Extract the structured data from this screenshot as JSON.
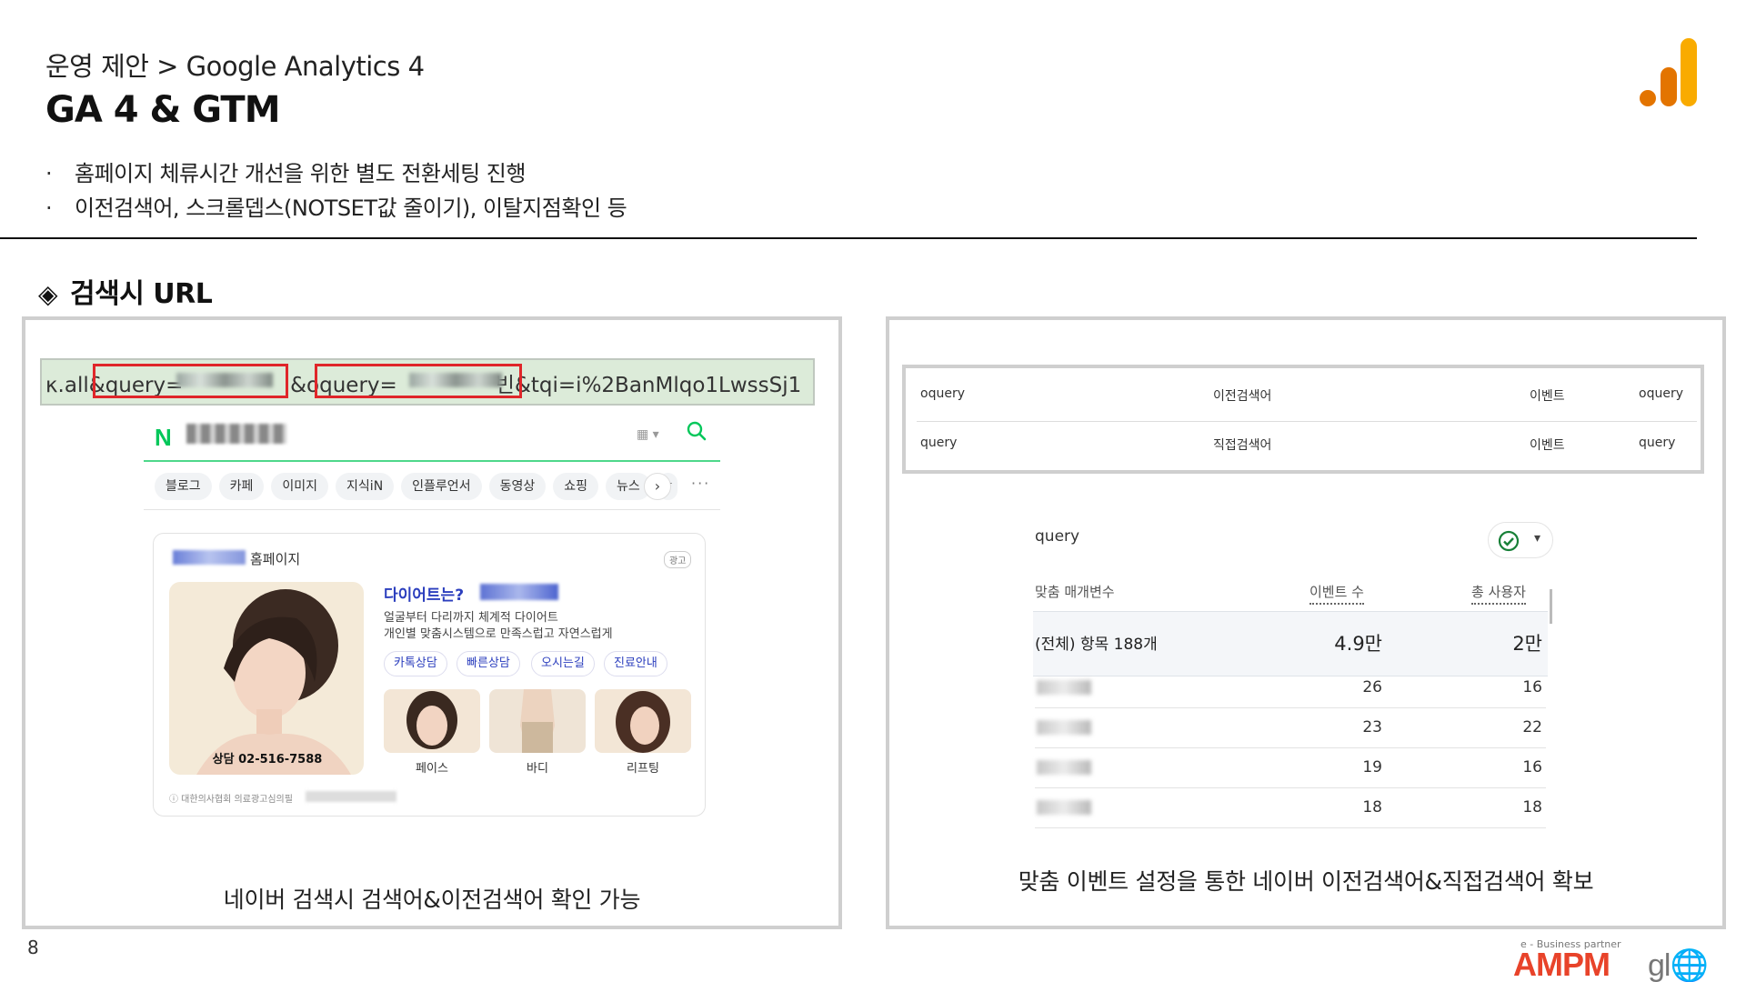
{
  "header": {
    "breadcrumb": "운영 제안 > Google Analytics 4",
    "title": "GA 4 & GTM",
    "bullets": [
      "홈페이지 체류시간 개선을 위한 별도 전환세팅 진행",
      "이전검색어, 스크롤뎁스(NOTSET값 줄이기), 이탈지점확인 등"
    ],
    "bullet_marker": "·",
    "logo_icon": "google-analytics-bars-icon",
    "logo_colors": [
      "#e37400",
      "#f9ab00"
    ]
  },
  "section": {
    "marker": "◈",
    "heading": "검색시 URL"
  },
  "left_panel": {
    "url": {
      "prefix": "κ.all&",
      "query_key": "query=",
      "mid": "|&",
      "oquery_key": "oquery=",
      "oquery_tail": "빈",
      "suffix": "&tqi=i%2BanMlqo1LwssSj1"
    },
    "naver": {
      "logo": "N",
      "kbd_icon": "▦ ▾",
      "search_icon": "search-icon",
      "tabs": [
        "블로그",
        "카페",
        "이미지",
        "지식iN",
        "인플루언서",
        "동영상",
        "쇼핑",
        "뉴스",
        "ㅎ"
      ],
      "tabs_next": "›",
      "tabs_more": "···",
      "ad": {
        "site_label": "홈페이지",
        "badge": "광고",
        "headline": "다이어트는?",
        "desc_line1": "얼굴부터 다리까지 체계적 다이어트",
        "desc_line2": "개인별 맞춤시스템으로 만족스럽고 자연스럽게",
        "buttons": [
          "카톡상담",
          "빠른상담",
          "오시는길",
          "진료안내"
        ],
        "phone": "상담 02-516-7588",
        "thumbs": [
          "페이스",
          "바디",
          "리프팅"
        ],
        "notice": "ⓘ 대한의사협회 의료광고심의필"
      }
    },
    "caption": "네이버 검색시 검색어&이전검색어 확인 가능"
  },
  "right_panel": {
    "param_table": [
      {
        "param": "oquery",
        "desc": "이전검색어",
        "scope": "이벤트",
        "name": "oquery"
      },
      {
        "param": "query",
        "desc": "직접검색어",
        "scope": "이벤트",
        "name": "query"
      }
    ],
    "report": {
      "title": "query",
      "status_icon": "check-circle-icon",
      "status_caret": "▾",
      "col_dimension": "맞춤 매개변수",
      "col_events": "이벤트 수",
      "col_users": "총 사용자",
      "total_label": "(전체) 항목 188개",
      "total_events": "4.9만",
      "total_users": "2만",
      "rows": [
        {
          "events": "26",
          "users": "16"
        },
        {
          "events": "23",
          "users": "22"
        },
        {
          "events": "19",
          "users": "16"
        },
        {
          "events": "18",
          "users": "18"
        }
      ]
    },
    "caption": "맞춤 이벤트 설정을 통한 네이버 이전검색어&직접검색어 확보"
  },
  "footer": {
    "page_number": "8",
    "tagline": "e - Business partner",
    "logo_ampm": "AMPM",
    "logo_global": "gl🌐bal",
    "logo_color": "#e8432a"
  }
}
